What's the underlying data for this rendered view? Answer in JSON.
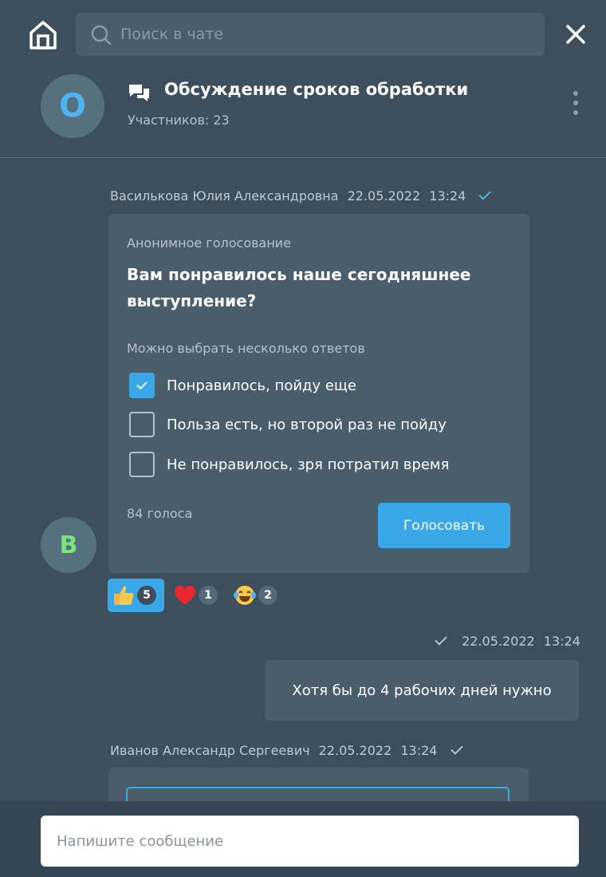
{
  "search": {
    "placeholder": "Поиск в чате"
  },
  "chat": {
    "avatar_letter": "О",
    "title": "Обсуждение сроков обработки",
    "participants": "Участников: 23"
  },
  "messages": [
    {
      "author": "Василькова Юлия Александровна",
      "date": "22.05.2022",
      "time": "13:24",
      "avatar_letter": "В",
      "poll": {
        "type": "Анонимное голосование",
        "question": "Вам понравилось наше сегодняшнее выступление?",
        "hint": "Можно выбрать несколько ответов",
        "options": [
          {
            "label": "Понравилось, пойду еще",
            "checked": true
          },
          {
            "label": "Польза есть, но второй раз не пойду",
            "checked": false
          },
          {
            "label": "Не понравилось, зря потратил время",
            "checked": false
          }
        ],
        "votes": "84 голоса",
        "vote_button": "Голосовать"
      },
      "reactions": [
        {
          "emoji": "thumbs-up",
          "count": "5",
          "active": true
        },
        {
          "emoji": "red-heart",
          "count": "1",
          "active": false
        },
        {
          "emoji": "tears-of-joy",
          "count": "2",
          "active": false
        }
      ]
    },
    {
      "outgoing": true,
      "date": "22.05.2022",
      "time": "13:24",
      "text": "Хотя бы до 4 рабочих дней нужно"
    },
    {
      "author": "Иванов Александр Сергеевич",
      "date": "22.05.2022",
      "time": "13:24"
    }
  ],
  "composer": {
    "placeholder": "Напишите сообщение"
  },
  "colors": {
    "background": "#3d4e5c",
    "card": "#4a5d6b",
    "accent": "#3aa8e8",
    "avatar_b": "#7be37e"
  }
}
